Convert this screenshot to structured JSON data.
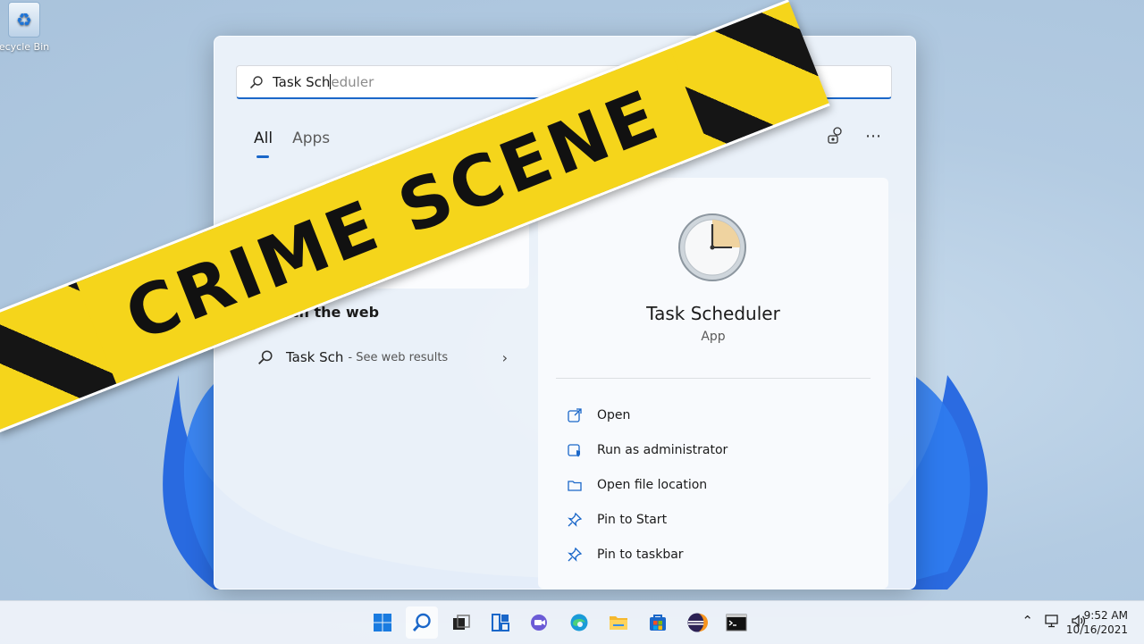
{
  "desktop": {
    "recycle_bin_label": "ecycle Bin"
  },
  "search": {
    "typed": "Task Sch",
    "suggestion": "eduler"
  },
  "tabs": [
    {
      "label": "All",
      "active": true
    },
    {
      "label": "Apps",
      "active": false
    }
  ],
  "web": {
    "section_title": "Search the web",
    "query": "Task Sch",
    "hint": "- See web results"
  },
  "detail": {
    "app_name": "Task Scheduler",
    "app_type": "App",
    "actions": [
      {
        "label": "Open",
        "icon": "open-external-icon"
      },
      {
        "label": "Run as administrator",
        "icon": "shield-icon"
      },
      {
        "label": "Open file location",
        "icon": "folder-icon"
      },
      {
        "label": "Pin to Start",
        "icon": "pin-icon"
      },
      {
        "label": "Pin to taskbar",
        "icon": "pin-icon"
      }
    ]
  },
  "overlay": {
    "tape_text": "CRIME SCENE"
  },
  "taskbar": {
    "apps": [
      "windows-start-icon",
      "search-icon",
      "task-view-icon",
      "widgets-icon",
      "chat-icon",
      "edge-icon",
      "file-explorer-icon",
      "store-icon",
      "eclipse-icon",
      "terminal-icon"
    ],
    "time": "9:52 AM",
    "date": "10/16/2021"
  },
  "colors": {
    "accent": "#1a67c9",
    "tape_yellow": "#f5d51b",
    "tape_black": "#151515"
  }
}
